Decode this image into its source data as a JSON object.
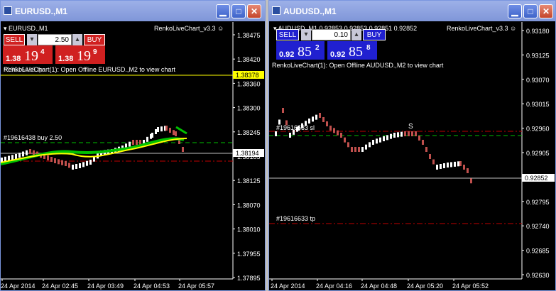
{
  "colors": {
    "up": "#ffffff",
    "down": "#c0504d",
    "green": "#00c000",
    "yellow": "#ffff00",
    "axis": "#ffffff",
    "grid": "#000000",
    "dash_green": "#00c000",
    "dash_red": "#c00000"
  },
  "win1": {
    "title": "EURUSD.,M1",
    "symbol": "EURUSD.,M1",
    "indicator": "RenkoLiveChart_v3.3",
    "sell": "SELL",
    "buy": "BUY",
    "lot": "2.50",
    "bid_small": "1.38",
    "bid_big": "19",
    "bid_sup": "4",
    "ask_small": "1.38",
    "ask_big": "19",
    "ask_sup": "9",
    "message": "RenkoLiveChart(1): Open Offline EURUSD.,M2 to view chart",
    "overlay_label": "#19616438 tp",
    "order_label": "#19616438 buy 2.50",
    "current_price": "1.38194",
    "highlight_price": "1.38378",
    "y_labels": [
      "1.38475",
      "1.38420",
      "1.38360",
      "1.38300",
      "1.38245",
      "1.38185",
      "1.38125",
      "1.38070",
      "1.38010",
      "1.37955",
      "1.37895"
    ],
    "x_labels": [
      "24 Apr 2014",
      "24 Apr 02:45",
      "24 Apr 03:49",
      "24 Apr 04:53",
      "24 Apr 05:57"
    ]
  },
  "win2": {
    "title": "AUDUSD.,M1",
    "symbol": "AUDUSD.,M1",
    "ohlc": "0.92853 0.92853 0.92851 0.92852",
    "indicator": "RenkoLiveChart_v3.3",
    "sell": "SELL",
    "buy": "BUY",
    "lot": "0.10",
    "bid_small": "0.92",
    "bid_big": "85",
    "bid_sup": "2",
    "ask_small": "0.92",
    "ask_big": "85",
    "ask_sup": "8",
    "message": "RenkoLiveChart(1): Open Offline AUDUSD.,M2 to view chart",
    "sl_label": "#19616633 sl",
    "tp_label": "#19616633 tp",
    "s_marker": "S",
    "current_price": "0.92852",
    "y_labels": [
      "0.93180",
      "0.93125",
      "0.93070",
      "0.93015",
      "0.92960",
      "0.92905",
      "0.92852",
      "0.92795",
      "0.92740",
      "0.92685",
      "0.92630"
    ],
    "x_labels": [
      "24 Apr 2014",
      "24 Apr 04:16",
      "24 Apr 04:48",
      "24 Apr 05:20",
      "24 Apr 05:52"
    ]
  }
}
